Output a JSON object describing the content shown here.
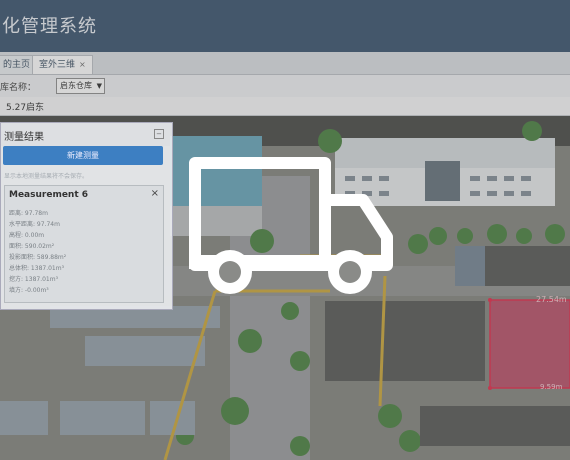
{
  "header": {
    "title": "化管理系统"
  },
  "tabs": [
    {
      "label": "的主页",
      "active": false
    },
    {
      "label": "室外三维",
      "active": true,
      "close": "×"
    }
  ],
  "toolbar": {
    "scene_label": "库名称：",
    "scene_value": "启东仓库"
  },
  "date_row": {
    "text": "5.27启东"
  },
  "measure_panel": {
    "title": "测量结果",
    "new_button": "新建测量",
    "hint": "显示本地测量结果将不会保存。",
    "card": {
      "title": "Measurement 6",
      "close": "×",
      "rows": [
        "距离:  97.78m",
        "水平距离:  97.74m",
        "高程:  0.00m",
        "面积:  590.02m²",
        "投影面积:  589.88m²",
        "总体积:  1387.01m³",
        "挖方:  1387.01m³",
        "填方:  -0.00m³"
      ]
    }
  },
  "map_labels": {
    "dim_top": "27.54m",
    "dim_bottom": "9.59m"
  },
  "icons": {
    "truck": "truck-icon"
  },
  "colors": {
    "header": "#2f4966",
    "button": "#3d7fc2",
    "selection": "#c8355a"
  }
}
